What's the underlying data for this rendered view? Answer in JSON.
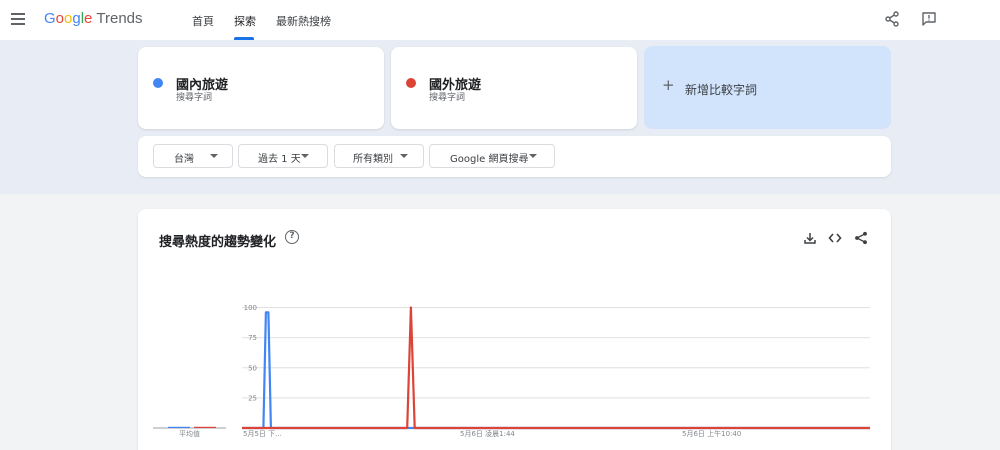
{
  "app": {
    "logo_google": "Google",
    "logo_trends": "Trends",
    "logo_colors": [
      "#4285f4",
      "#ea4335",
      "#fbbc05",
      "#4285f4",
      "#34a853",
      "#ea4335"
    ]
  },
  "nav": {
    "items": [
      "首頁",
      "探索",
      "最新熱搜榜"
    ],
    "active": "探索"
  },
  "icons": {
    "menu": "hamburger-menu-icon",
    "share": "share-icon",
    "feedback": "feedback-icon",
    "download": "download-icon",
    "embed": "embed-code-icon",
    "help": "help-icon"
  },
  "terms": [
    {
      "name": "國內旅遊",
      "subtitle": "搜尋字詞",
      "color": "#4285f4"
    },
    {
      "name": "國外旅遊",
      "subtitle": "搜尋字詞",
      "color": "#db4437"
    }
  ],
  "add_compare": {
    "plus": "+",
    "label": "新增比較字詞"
  },
  "filters": {
    "region": "台灣",
    "period": "過去 1 天",
    "category": "所有類別",
    "property": "Google 網頁搜尋"
  },
  "card": {
    "title": "搜尋熱度的趨勢變化",
    "help": "?"
  },
  "chart_data": {
    "type": "line",
    "y_ticks": [
      "100",
      "75",
      "50",
      "25"
    ],
    "ylim": [
      0,
      100
    ],
    "x_tick_labels": [
      "5月5日 下...",
      "5月6日 凌晨1:44",
      "5月6日 上午10:40"
    ],
    "average_label": "平均值",
    "averages": [
      {
        "name": "國內旅遊",
        "value": 1
      },
      {
        "name": "國外旅遊",
        "value": 1
      }
    ],
    "series": [
      {
        "name": "國內旅遊",
        "color": "#4285f4",
        "x": [
          0,
          0.034,
          0.038,
          0.042,
          0.046,
          1
        ],
        "values": [
          0,
          0,
          96,
          96,
          0,
          0
        ]
      },
      {
        "name": "國外旅遊",
        "color": "#db4437",
        "x": [
          0,
          0.263,
          0.269,
          0.275,
          1
        ],
        "values": [
          0,
          0,
          100,
          0,
          0
        ]
      }
    ]
  }
}
